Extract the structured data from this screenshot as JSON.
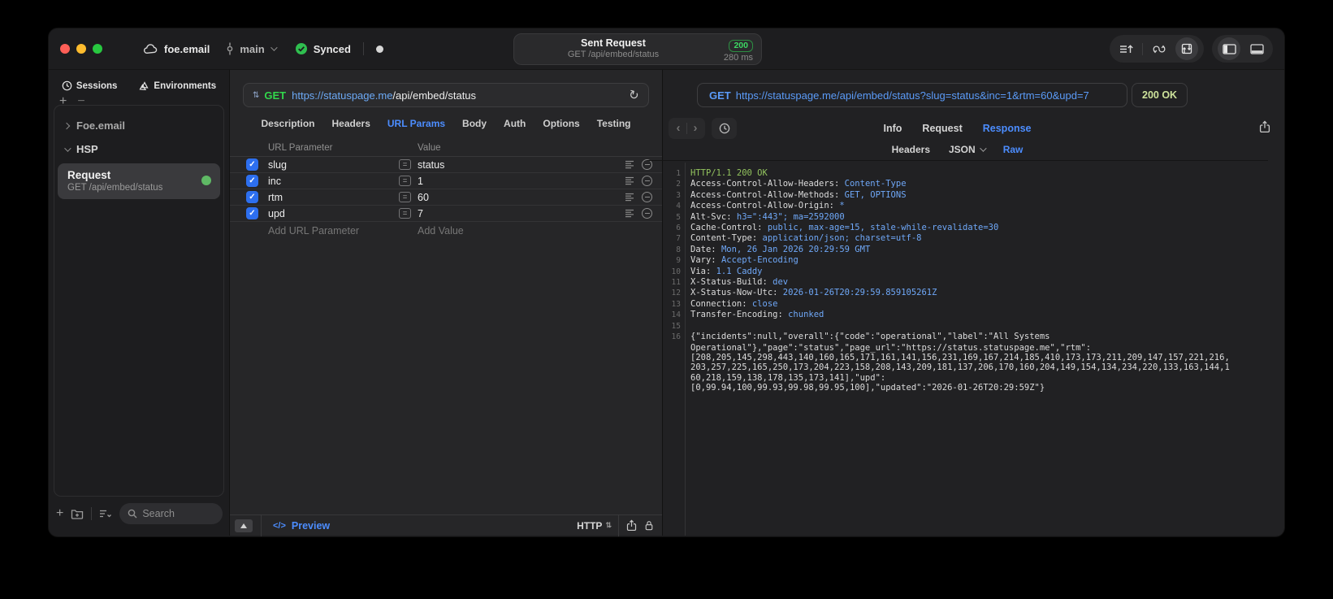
{
  "colors": {
    "accent_blue": "#4c8dff",
    "method_green": "#32d74b",
    "status_200_green": "#3cd963",
    "status_ok_olive": "#cde29b",
    "checkbox_blue": "#2d6fef",
    "mono_value_blue": "#6fa8f8",
    "status_line_green": "#92c35e",
    "window_bg": "#1d1d1f",
    "editor_bg": "#262628",
    "viewer_bg": "#212123",
    "record_green_dot": "#5fb965"
  },
  "titlebar": {
    "project": "foe.email",
    "branch": "main",
    "sync_label": "Synced",
    "request": {
      "title": "Sent Request",
      "subtitle": "GET /api/embed/status",
      "status": "200",
      "time": "280 ms"
    }
  },
  "sidebar": {
    "tabs": {
      "sessions": "Sessions",
      "environments": "Environments"
    },
    "plus": "+",
    "minus": "−",
    "tree": {
      "group1": "Foe.email",
      "group2": "HSP"
    },
    "request_item": {
      "title": "Request",
      "subtitle": "GET /api/embed/status"
    },
    "search_placeholder": "Search"
  },
  "editor": {
    "method": "GET",
    "url_host": "https://statuspage.me",
    "url_path": "/api/embed/status",
    "tabs": [
      "Description",
      "Headers",
      "URL Params",
      "Body",
      "Auth",
      "Options",
      "Testing"
    ],
    "active_tab": "URL Params",
    "table": {
      "col_param": "URL Parameter",
      "col_value": "Value",
      "eq": "=",
      "check": "✓",
      "rows": [
        {
          "name": "slug",
          "value": "status"
        },
        {
          "name": "inc",
          "value": "1"
        },
        {
          "name": "rtm",
          "value": "60"
        },
        {
          "name": "upd",
          "value": "7"
        }
      ],
      "add_param": "Add URL Parameter",
      "add_value": "Add Value"
    },
    "footer": {
      "code_glyph": "</>",
      "preview": "Preview",
      "protocol": "HTTP"
    }
  },
  "viewer": {
    "method": "GET",
    "url": "https://statuspage.me/api/embed/status?slug=status&inc=1&rtm=60&upd=7",
    "status": "200 OK",
    "tabs": [
      "Info",
      "Request",
      "Response"
    ],
    "active_tab": "Response",
    "subtabs": [
      "Headers",
      "JSON",
      "Raw"
    ],
    "active_subtab": "Raw",
    "lines": [
      {
        "n": "1",
        "parts": [
          {
            "t": "HTTP/1.1 200 OK",
            "c": "green"
          }
        ]
      },
      {
        "n": "2",
        "parts": [
          {
            "t": "Access-Control-Allow-Headers: "
          },
          {
            "t": "Content-Type",
            "c": "blue"
          }
        ]
      },
      {
        "n": "3",
        "parts": [
          {
            "t": "Access-Control-Allow-Methods: "
          },
          {
            "t": "GET, OPTIONS",
            "c": "blue"
          }
        ]
      },
      {
        "n": "4",
        "parts": [
          {
            "t": "Access-Control-Allow-Origin: "
          },
          {
            "t": "*",
            "c": "blue"
          }
        ]
      },
      {
        "n": "5",
        "parts": [
          {
            "t": "Alt-Svc: "
          },
          {
            "t": "h3=\":443\"; ma=2592000",
            "c": "blue"
          }
        ]
      },
      {
        "n": "6",
        "parts": [
          {
            "t": "Cache-Control: "
          },
          {
            "t": "public, max-age=15, stale-while-revalidate=30",
            "c": "blue"
          }
        ]
      },
      {
        "n": "7",
        "parts": [
          {
            "t": "Content-Type: "
          },
          {
            "t": "application/json; charset=utf-8",
            "c": "blue"
          }
        ]
      },
      {
        "n": "8",
        "parts": [
          {
            "t": "Date: "
          },
          {
            "t": "Mon, 26 Jan 2026 20:29:59 GMT",
            "c": "blue"
          }
        ]
      },
      {
        "n": "9",
        "parts": [
          {
            "t": "Vary: "
          },
          {
            "t": "Accept-Encoding",
            "c": "blue"
          }
        ]
      },
      {
        "n": "10",
        "parts": [
          {
            "t": "Via: "
          },
          {
            "t": "1.1 Caddy",
            "c": "blue"
          }
        ]
      },
      {
        "n": "11",
        "parts": [
          {
            "t": "X-Status-Build: "
          },
          {
            "t": "dev",
            "c": "blue"
          }
        ]
      },
      {
        "n": "12",
        "parts": [
          {
            "t": "X-Status-Now-Utc: "
          },
          {
            "t": "2026-01-26T20:29:59.859105261Z",
            "c": "blue"
          }
        ]
      },
      {
        "n": "13",
        "parts": [
          {
            "t": "Connection: "
          },
          {
            "t": "close",
            "c": "blue"
          }
        ]
      },
      {
        "n": "14",
        "parts": [
          {
            "t": "Transfer-Encoding: "
          },
          {
            "t": "chunked",
            "c": "blue"
          }
        ]
      },
      {
        "n": "15",
        "parts": []
      },
      {
        "n": "16",
        "parts": [
          {
            "t": "{\"incidents\":null,\"overall\":{\"code\":\"operational\",\"label\":\"All Systems"
          }
        ]
      },
      {
        "n": "",
        "parts": [
          {
            "t": "Operational\"},\"page\":\"status\",\"page_url\":\"https://status.statuspage.me\",\"rtm\":"
          }
        ]
      },
      {
        "n": "",
        "parts": [
          {
            "t": "[208,205,145,298,443,140,160,165,171,161,141,156,231,169,167,214,185,410,173,173,211,209,147,157,221,216,"
          }
        ]
      },
      {
        "n": "",
        "parts": [
          {
            "t": "203,257,225,165,250,173,204,223,158,208,143,209,181,137,206,170,160,204,149,154,134,234,220,133,163,144,1"
          }
        ]
      },
      {
        "n": "",
        "parts": [
          {
            "t": "60,218,159,138,178,135,173,141],\"upd\":"
          }
        ]
      },
      {
        "n": "",
        "parts": [
          {
            "t": "[0,99.94,100,99.93,99.98,99.95,100],\"updated\":\"2026-01-26T20:29:59Z\"}"
          }
        ]
      }
    ]
  }
}
